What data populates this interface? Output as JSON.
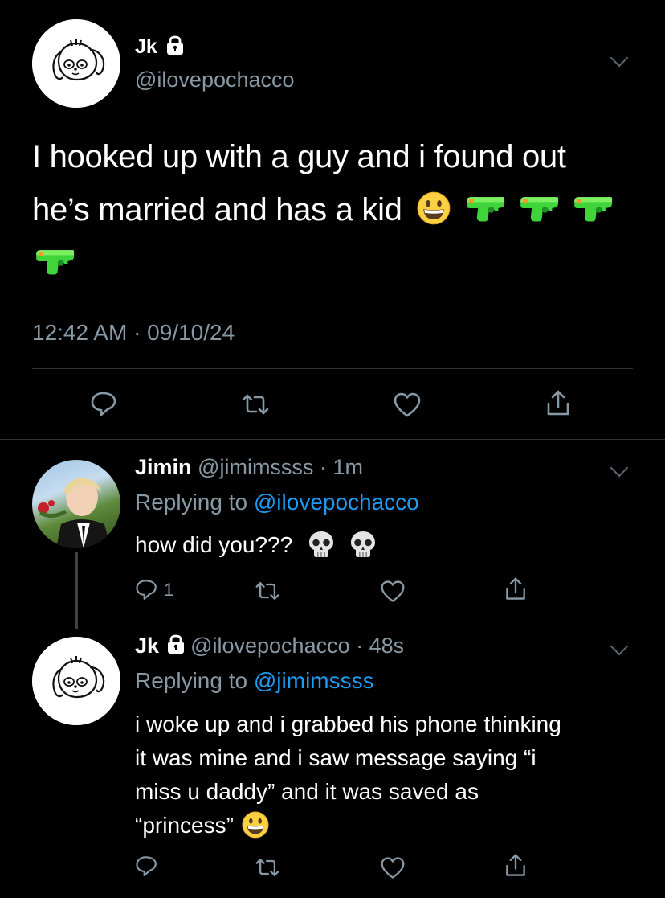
{
  "main_tweet": {
    "author_name": "Jk",
    "author_handle": "@ilovepochacco",
    "text_line1": "I hooked up with a guy and i found out",
    "text_line2": "he’s married and has a kid",
    "emojis": [
      "grinning-face",
      "water-pistol",
      "water-pistol",
      "water-pistol",
      "water-pistol"
    ],
    "timestamp": "12:42 AM · 09/10/24"
  },
  "replies": [
    {
      "author_name": "Jimin",
      "author_handle": "@jimimssss",
      "time": "· 1m",
      "replying_prefix": "Replying to",
      "replying_to": "@ilovepochacco",
      "text": "how did you???",
      "emojis": [
        "skull",
        "skull"
      ],
      "reply_count": "1"
    },
    {
      "author_name": "Jk",
      "author_handle": "@ilovepochacco",
      "time": "· 48s",
      "replying_prefix": "Replying to",
      "replying_to": "@jimimssss",
      "text_lines": [
        "i woke up and i grabbed his phone thinking",
        "it was mine and i saw message saying “i",
        "miss u daddy” and it was saved as",
        "“princess”"
      ],
      "emojis": [
        "grinning-face"
      ]
    }
  ],
  "colors": {
    "background": "#000000",
    "secondary_text": "#8899a6",
    "link": "#1d9bf0",
    "divider": "#2f3336"
  }
}
